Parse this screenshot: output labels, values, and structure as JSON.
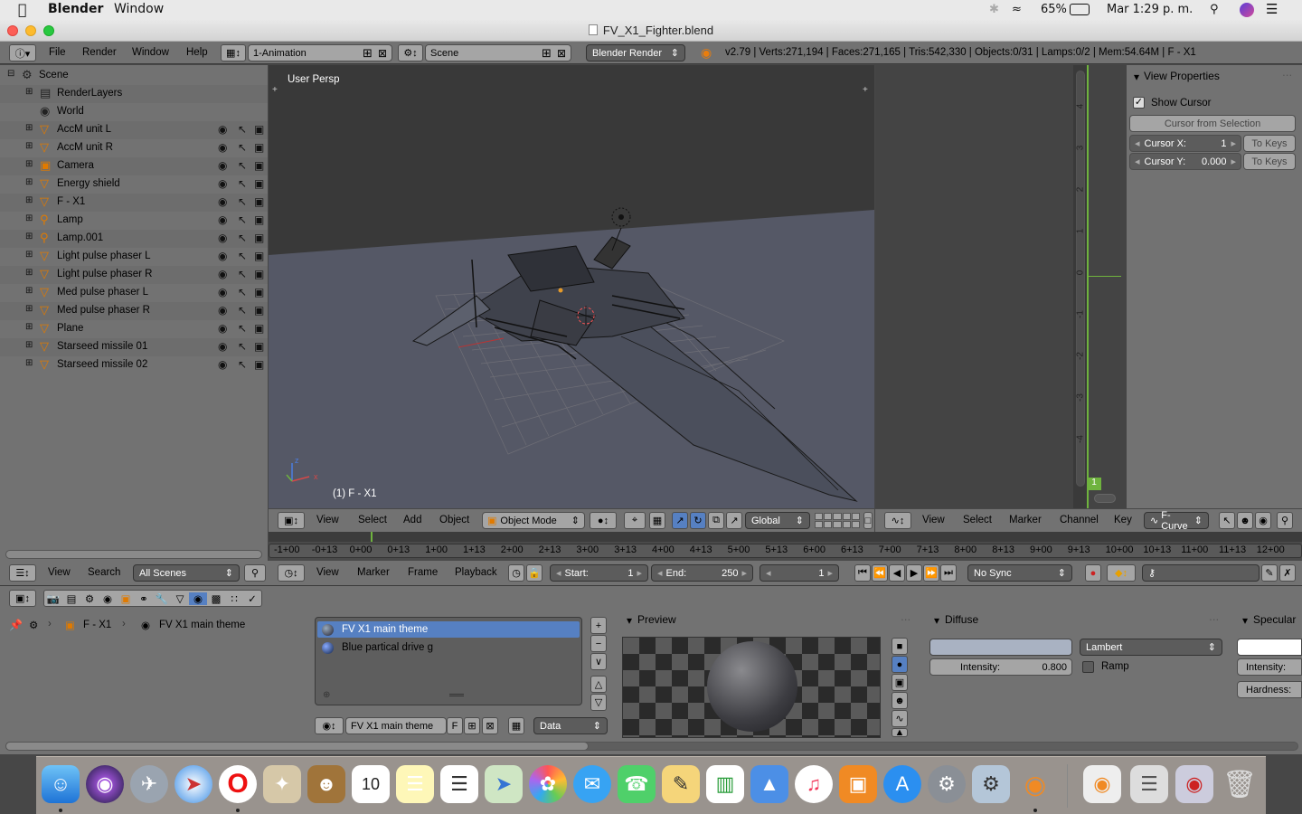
{
  "menubar": {
    "app_name": "Blender",
    "window_menu": "Window",
    "battery": "65%",
    "clock": "Mar 1:29 p. m."
  },
  "window": {
    "title": "FV_X1_Fighter.blend"
  },
  "info_header": {
    "menus": [
      "File",
      "Render",
      "Window",
      "Help"
    ],
    "screen_layout": "1-Animation",
    "scene": "Scene",
    "render_engine": "Blender Render",
    "stats": "v2.79 | Verts:271,194 | Faces:271,165 | Tris:542,330 | Objects:0/31 | Lamps:0/2 | Mem:54.64M | F - X1"
  },
  "outliner": {
    "items": [
      {
        "label": "Scene",
        "type": "scene"
      },
      {
        "label": "RenderLayers",
        "type": "renderlayers"
      },
      {
        "label": "World",
        "type": "world"
      },
      {
        "label": "AccM unit L",
        "type": "mesh"
      },
      {
        "label": "AccM unit R",
        "type": "mesh"
      },
      {
        "label": "Camera",
        "type": "camera"
      },
      {
        "label": "Energy shield",
        "type": "mesh"
      },
      {
        "label": "F - X1",
        "type": "mesh"
      },
      {
        "label": "Lamp",
        "type": "lamp"
      },
      {
        "label": "Lamp.001",
        "type": "lamp"
      },
      {
        "label": "Light pulse phaser L",
        "type": "mesh"
      },
      {
        "label": "Light pulse phaser R",
        "type": "mesh"
      },
      {
        "label": "Med pulse phaser L",
        "type": "mesh"
      },
      {
        "label": "Med pulse phaser R",
        "type": "mesh"
      },
      {
        "label": "Plane",
        "type": "mesh"
      },
      {
        "label": "Starseed missile 01",
        "type": "mesh"
      },
      {
        "label": "Starseed missile 02",
        "type": "mesh"
      }
    ]
  },
  "viewport": {
    "persp_label": "User Persp",
    "object_label": "(1) F - X1",
    "menus": [
      "View",
      "Select",
      "Add",
      "Object"
    ],
    "mode": "Object Mode",
    "orientation": "Global"
  },
  "graph_editor": {
    "menus": [
      "View",
      "Select",
      "Marker",
      "Channel",
      "Key"
    ],
    "mode": "F-Curve",
    "axis_labels": [
      "4",
      "3",
      "2",
      "1",
      "0",
      "-1",
      "-2",
      "-3",
      "-4"
    ],
    "frame_badge": "1"
  },
  "view_properties": {
    "panel_title": "View Properties",
    "show_cursor": "Show Cursor",
    "cursor_from_selection": "Cursor from Selection",
    "cursor_x_label": "Cursor X:",
    "cursor_x_value": "1",
    "cursor_y_label": "Cursor Y:",
    "cursor_y_value": "0.000",
    "to_keys": "To Keys"
  },
  "timeline": {
    "ticks": [
      "-1+00",
      "-0+13",
      "0+00",
      "0+13",
      "1+00",
      "1+13",
      "2+00",
      "2+13",
      "3+00",
      "3+13",
      "4+00",
      "4+13",
      "5+00",
      "5+13",
      "6+00",
      "6+13",
      "7+00",
      "7+13",
      "8+00",
      "8+13",
      "9+00",
      "9+13",
      "10+00",
      "10+13",
      "11+00",
      "11+13",
      "12+00"
    ],
    "menus": [
      "View",
      "Marker",
      "Frame",
      "Playback"
    ],
    "start_label": "Start:",
    "start_value": "1",
    "end_label": "End:",
    "end_value": "250",
    "current_frame": "1",
    "sync": "No Sync"
  },
  "outliner_header": {
    "menus": [
      "View",
      "Search"
    ],
    "filter": "All Scenes"
  },
  "material": {
    "breadcrumb_object": "F - X1",
    "breadcrumb_material": "FV X1 main theme",
    "slots": [
      "FV X1 main theme",
      "Blue partical drive g"
    ],
    "material_name": "FV X1 main theme",
    "fake_user": "F",
    "link": "Data",
    "preview_title": "Preview",
    "diffuse_title": "Diffuse",
    "diffuse_shader": "Lambert",
    "intensity_label": "Intensity:",
    "intensity_value": "0.800",
    "ramp_label": "Ramp",
    "specular_title": "Specular",
    "specular_intensity_label": "Intensity:",
    "hardness_label": "Hardness:"
  },
  "colors": {
    "blender_panel": "#727272",
    "viewport_bg": "#393939",
    "selected_slot": "#5680c2",
    "object_orange": "#e07a00",
    "graph_green": "#6fb33e"
  }
}
